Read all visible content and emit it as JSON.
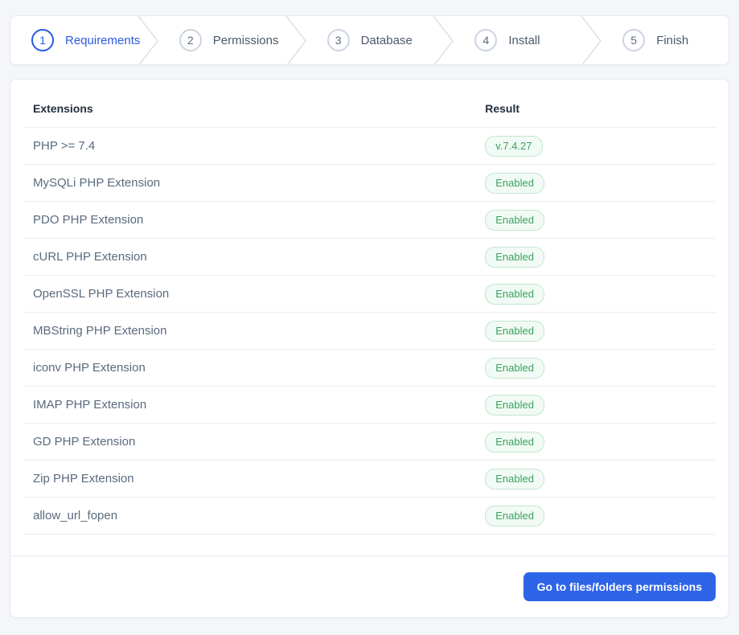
{
  "stepper": {
    "steps": [
      {
        "number": "1",
        "label": "Requirements",
        "active": true
      },
      {
        "number": "2",
        "label": "Permissions",
        "active": false
      },
      {
        "number": "3",
        "label": "Database",
        "active": false
      },
      {
        "number": "4",
        "label": "Install",
        "active": false
      },
      {
        "number": "5",
        "label": "Finish",
        "active": false
      }
    ]
  },
  "requirements": {
    "columns": {
      "extensions": "Extensions",
      "result": "Result"
    },
    "rows": [
      {
        "extension": "PHP >= 7.4",
        "result": "v.7.4.27"
      },
      {
        "extension": "MySQLi PHP Extension",
        "result": "Enabled"
      },
      {
        "extension": "PDO PHP Extension",
        "result": "Enabled"
      },
      {
        "extension": "cURL PHP Extension",
        "result": "Enabled"
      },
      {
        "extension": "OpenSSL PHP Extension",
        "result": "Enabled"
      },
      {
        "extension": "MBString PHP Extension",
        "result": "Enabled"
      },
      {
        "extension": "iconv PHP Extension",
        "result": "Enabled"
      },
      {
        "extension": "IMAP PHP Extension",
        "result": "Enabled"
      },
      {
        "extension": "GD PHP Extension",
        "result": "Enabled"
      },
      {
        "extension": "Zip PHP Extension",
        "result": "Enabled"
      },
      {
        "extension": "allow_url_fopen",
        "result": "Enabled"
      }
    ]
  },
  "footer": {
    "next_button_label": "Go to files/folders permissions"
  },
  "colors": {
    "accent_blue": "#2b59e0",
    "button_blue": "#2d64e8",
    "badge_green_text": "#39a35d",
    "badge_green_bg": "#f1faf4",
    "badge_green_border": "#c2e7cf",
    "page_background": "#f4f6fa"
  }
}
